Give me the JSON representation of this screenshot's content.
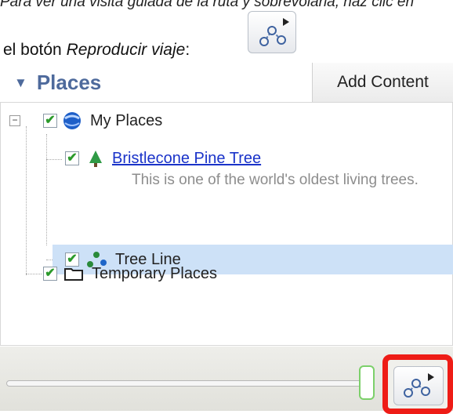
{
  "document": {
    "top_text": "Para ver una visita guiada de la ruta y sobrevolarla, haz clic en",
    "instruction_prefix": "el botón ",
    "instruction_em": "Reproducir viaje",
    "instruction_suffix": ":"
  },
  "panel": {
    "title": "Places",
    "add_content_label": "Add Content",
    "tree": {
      "my_places": "My Places",
      "bristlecone": "Bristlecone Pine Tree",
      "bristlecone_desc": "This is one of the world's oldest living trees.",
      "tree_line": "Tree Line",
      "temporary_places": "Temporary Places"
    }
  },
  "colors": {
    "header_blue": "#4e6a9c",
    "selection": "#cde1f7",
    "highlight_red": "#ee1c16",
    "check_green": "#2b9a2b",
    "link_blue": "#1a33c9"
  },
  "icons": {
    "earth": "earth-icon",
    "tree": "tree-icon",
    "path": "path-icon",
    "folder": "folder-icon",
    "play_tour": "play-tour-icon"
  }
}
